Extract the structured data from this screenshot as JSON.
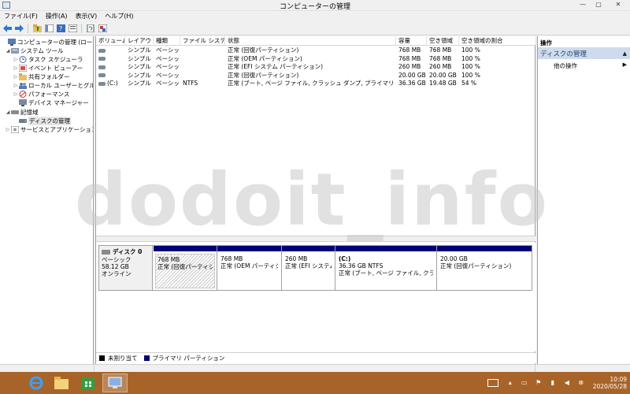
{
  "window": {
    "title": "コンピューターの管理",
    "min": "—",
    "max": "▢",
    "close": "✕"
  },
  "menubar": [
    {
      "label": "ファイル(F)"
    },
    {
      "label": "操作(A)"
    },
    {
      "label": "表示(V)"
    },
    {
      "label": "ヘルプ(H)"
    }
  ],
  "tree": {
    "items": [
      {
        "label": "コンピューターの管理 (ローカル)",
        "expander": ""
      },
      {
        "label": "システム ツール",
        "expander": "◢"
      },
      {
        "label": "タスク スケジューラ",
        "expander": "▷"
      },
      {
        "label": "イベント ビューアー",
        "expander": "▷"
      },
      {
        "label": "共有フォルダー",
        "expander": "▷"
      },
      {
        "label": "ローカル ユーザーとグループ",
        "expander": "▷"
      },
      {
        "label": "パフォーマンス",
        "expander": "▷"
      },
      {
        "label": "デバイス マネージャー",
        "expander": ""
      },
      {
        "label": "記憶域",
        "expander": "◢"
      },
      {
        "label": "ディスクの管理",
        "expander": ""
      },
      {
        "label": "サービスとアプリケーション",
        "expander": "▷"
      }
    ]
  },
  "volumes": {
    "headers": [
      "ボリューム",
      "レイアウト",
      "種類",
      "ファイル システム",
      "状態",
      "容量",
      "空き領域",
      "空き領域の割合"
    ],
    "rows": [
      {
        "volume": "",
        "layout": "シンプル",
        "type": "ベーシック",
        "fs": "",
        "status": "正常 (回復パーティション)",
        "capacity": "768 MB",
        "free": "768 MB",
        "pct": "100 %"
      },
      {
        "volume": "",
        "layout": "シンプル",
        "type": "ベーシック",
        "fs": "",
        "status": "正常 (OEM パーティション)",
        "capacity": "768 MB",
        "free": "768 MB",
        "pct": "100 %"
      },
      {
        "volume": "",
        "layout": "シンプル",
        "type": "ベーシック",
        "fs": "",
        "status": "正常 (EFI システム パーティション)",
        "capacity": "260 MB",
        "free": "260 MB",
        "pct": "100 %"
      },
      {
        "volume": "",
        "layout": "シンプル",
        "type": "ベーシック",
        "fs": "",
        "status": "正常 (回復パーティション)",
        "capacity": "20.00 GB",
        "free": "20.00 GB",
        "pct": "100 %"
      },
      {
        "volume": "(C:)",
        "layout": "シンプル",
        "type": "ベーシック",
        "fs": "NTFS",
        "status": "正常 (ブート, ページ ファイル, クラッシュ ダンプ, プライマリ パーティション)",
        "capacity": "36.36 GB",
        "free": "19.48 GB",
        "pct": "54 %"
      }
    ]
  },
  "disk": {
    "name": "ディスク 0",
    "type": "ベーシック",
    "size": "58.12 GB",
    "state": "オンライン",
    "partitions": [
      {
        "name": "",
        "size": "768 MB",
        "status": "正常 (回復パーティション)"
      },
      {
        "name": "",
        "size": "768 MB",
        "status": "正常 (OEM パーティション)"
      },
      {
        "name": "",
        "size": "260 MB",
        "status": "正常 (EFI システム"
      },
      {
        "name": "(C:)",
        "size": "36.36 GB NTFS",
        "status": "正常 (ブート, ページ ファイル, クラッシュ ダ"
      },
      {
        "name": "",
        "size": "20.00 GB",
        "status": "正常 (回復パーティション)"
      }
    ]
  },
  "legend": [
    {
      "label": "未割り当て",
      "color": "#000000"
    },
    {
      "label": "プライマリ パーティション",
      "color": "#00007a"
    }
  ],
  "actions": {
    "header": "操作",
    "section": "ディスクの管理",
    "section_arrow": "▲",
    "items": [
      {
        "label": "他の操作",
        "arrow": "▶"
      }
    ]
  },
  "taskbar": {
    "clock_time": "10:09",
    "clock_date": "2020/05/28",
    "colors": {
      "bar": "#a86428"
    }
  },
  "watermark": "dodoit_info"
}
